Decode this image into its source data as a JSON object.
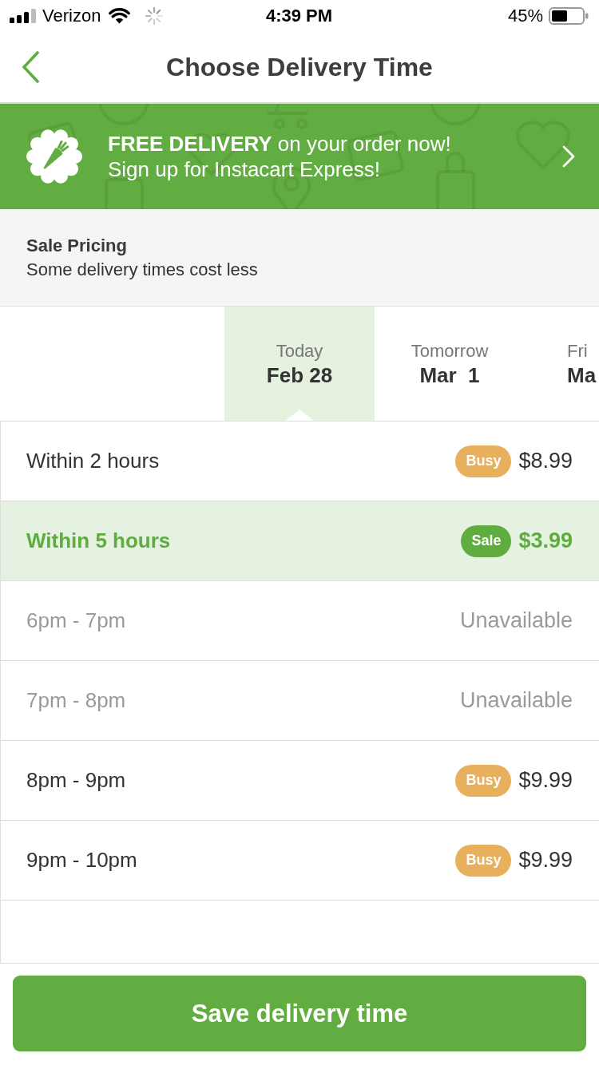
{
  "status_bar": {
    "carrier": "Verizon",
    "time": "4:39 PM",
    "battery": "45%"
  },
  "nav": {
    "title": "Choose Delivery Time"
  },
  "promo_banner": {
    "lines": [
      "**FREE DELIVERY** on your order now!",
      "Sign up for Instacart Express!"
    ]
  },
  "notice": {
    "title": "Sale Pricing",
    "text": "Some delivery times cost less"
  },
  "date_tabs": [
    {
      "day": "Today",
      "date": "Feb 28",
      "selected": true
    },
    {
      "day": "Tomorrow",
      "date": "Mar  1",
      "selected": false
    },
    {
      "day": "Fri",
      "date": "Ma",
      "selected": false
    }
  ],
  "time_slots": [
    {
      "label": "Within 2 hours",
      "badge": {
        "text": "Busy",
        "kind": "busy"
      },
      "value": "$8.99",
      "selected": false,
      "disabled": false
    },
    {
      "label": "Within 5 hours",
      "badge": {
        "text": "Sale",
        "kind": "sale"
      },
      "value": "$3.99",
      "selected": true,
      "disabled": false
    },
    {
      "label": "6pm - 7pm",
      "value": "Unavailable",
      "selected": false,
      "disabled": true
    },
    {
      "label": "7pm - 8pm",
      "value": "Unavailable",
      "selected": false,
      "disabled": true
    },
    {
      "label": "8pm - 9pm",
      "badge": {
        "text": "Busy",
        "kind": "busy"
      },
      "value": "$9.99",
      "selected": false,
      "disabled": false
    },
    {
      "label": "9pm - 10pm",
      "badge": {
        "text": "Busy",
        "kind": "busy"
      },
      "value": "$9.99",
      "selected": false,
      "disabled": false
    }
  ],
  "save_button": {
    "label": "Save delivery time"
  }
}
